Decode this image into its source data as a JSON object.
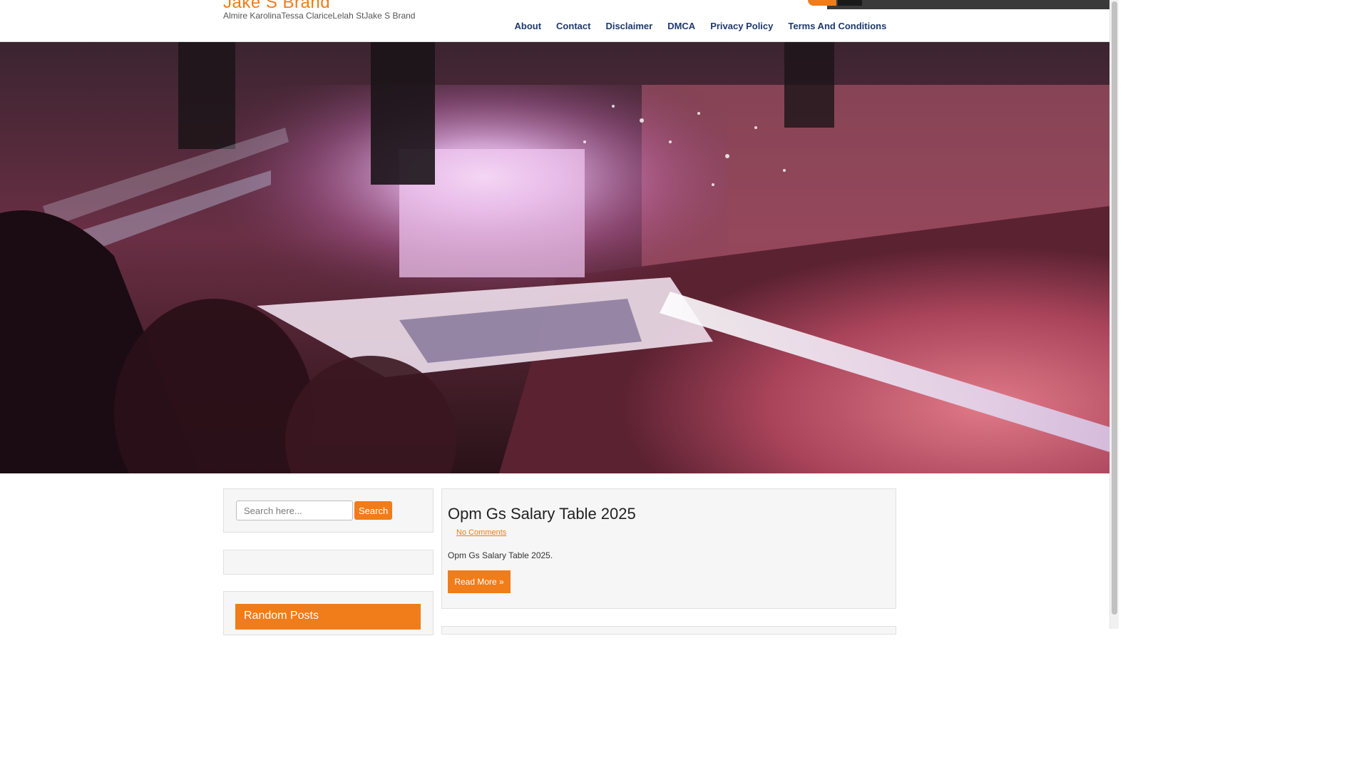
{
  "site": {
    "title": "Jake S Brand",
    "tagline": "Almire KarolinaTessa ClariceLelah StJake S Brand"
  },
  "nav": {
    "items": [
      "About",
      "Contact",
      "Disclaimer",
      "DMCA",
      "Privacy Policy",
      "Terms And Conditions"
    ]
  },
  "hero": {
    "description_icon": "concert-arena-photo-icon"
  },
  "sidebar": {
    "search": {
      "placeholder": "Search here...",
      "button_label": "Search"
    },
    "random_posts_title": "Random Posts"
  },
  "post": {
    "title": "Opm Gs Salary Table 2025",
    "comments": "No Comments",
    "excerpt": "Opm Gs Salary Table 2025.",
    "read_more": "Read More »"
  },
  "colors": {
    "accent": "#f07c1a",
    "nav_text": "#1e3a6e",
    "panel_bg": "#f6f6f6"
  }
}
